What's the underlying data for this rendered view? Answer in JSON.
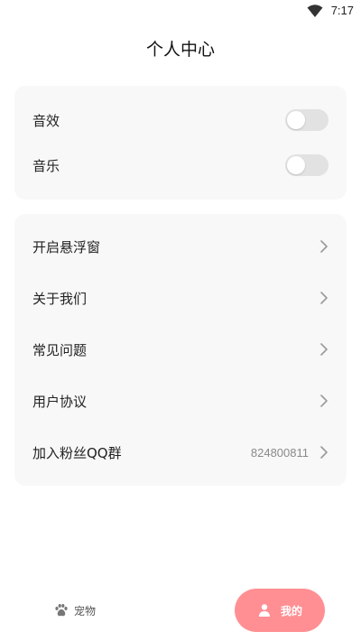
{
  "status_bar": {
    "time": "7:17",
    "wifi_icon": "wifi-icon"
  },
  "header": {
    "title": "个人中心"
  },
  "settings": {
    "items": [
      {
        "label": "音效",
        "enabled": false
      },
      {
        "label": "音乐",
        "enabled": false
      }
    ]
  },
  "menu": {
    "items": [
      {
        "label": "开启悬浮窗",
        "value": ""
      },
      {
        "label": "关于我们",
        "value": ""
      },
      {
        "label": "常见问题",
        "value": ""
      },
      {
        "label": "用户协议",
        "value": ""
      },
      {
        "label": "加入粉丝QQ群",
        "value": "824800811"
      }
    ],
    "chevron_icon": "chevron-right-icon"
  },
  "tab_bar": {
    "tabs": [
      {
        "label": "宠物",
        "icon": "paw-icon",
        "active": false
      },
      {
        "label": "我的",
        "icon": "user-icon",
        "active": true
      }
    ]
  },
  "colors": {
    "accent": "#ff8f93",
    "card_background": "#f8f8f8",
    "toggle_off": "#e2e2e2"
  }
}
